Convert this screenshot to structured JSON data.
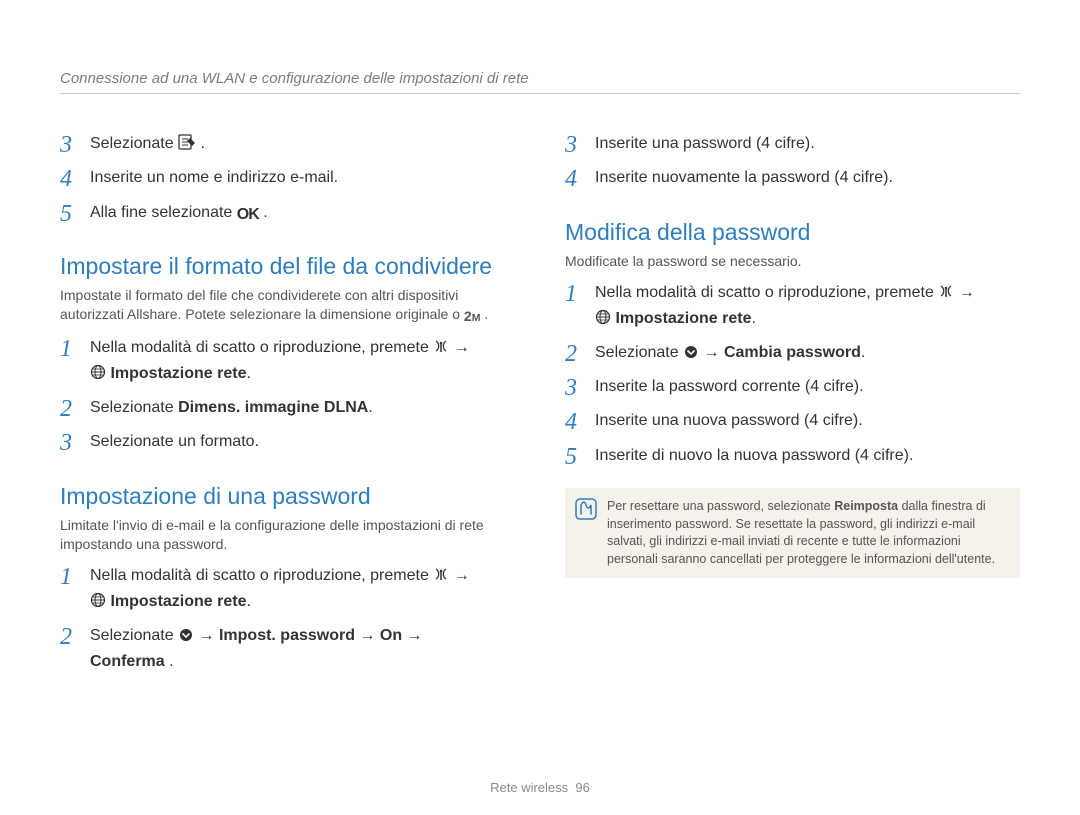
{
  "breadcrumb": "Connessione ad una WLAN e configurazione delle impostazioni di rete",
  "left": {
    "top_steps": [
      {
        "n": "3",
        "pre": "Selezionate ",
        "icon": "note-edit",
        "post": "."
      },
      {
        "n": "4",
        "pre": "Inserite un nome e indirizzo e-mail."
      },
      {
        "n": "5",
        "pre": "Alla fine selezionate ",
        "icon": "ok-text",
        "post": "."
      }
    ],
    "sec1_title": "Impostare il formato del file da condividere",
    "sec1_desc_a": "Impostate il formato del file che condividerete con altri dispositivi autorizzati Allshare. Potete selezionare la dimensione originale o ",
    "sec1_desc_icon": "2m",
    "sec1_desc_b": ".",
    "sec1_steps": [
      {
        "n": "1",
        "pre": "Nella modalità di scatto o riproduzione, premete ",
        "icon": "antenna",
        "post": " → ",
        "icon2": "globe",
        "bold": "Impostazione rete",
        "tail": "."
      },
      {
        "n": "2",
        "pre": "Selezionate ",
        "bold": "Dimens. immagine DLNA",
        "tail": "."
      },
      {
        "n": "3",
        "pre": "Selezionate un formato."
      }
    ],
    "sec2_title": "Impostazione di una password",
    "sec2_desc": "Limitate l'invio di e-mail e la configurazione delle impostazioni di rete impostando una password.",
    "sec2_steps": [
      {
        "n": "1",
        "pre": "Nella modalità di scatto o riproduzione, premete ",
        "icon": "antenna",
        "post": " → ",
        "icon2": "globe",
        "bold": "Impostazione rete",
        "tail": "."
      },
      {
        "n": "2",
        "pre": "Selezionate ",
        "icon": "chevron-down",
        "post": " → ",
        "bold": "Impost. password",
        "tail": " → ",
        "bold2": "On",
        "tail2": " → ",
        "bold3": "Conferma",
        "tail3": " ."
      }
    ]
  },
  "right": {
    "top_steps": [
      {
        "n": "3",
        "pre": "Inserite una password (4 cifre)."
      },
      {
        "n": "4",
        "pre": "Inserite nuovamente la password (4 cifre)."
      }
    ],
    "sec1_title": "Modifica della password",
    "sec1_desc": "Modificate la password se necessario.",
    "sec1_steps": [
      {
        "n": "1",
        "pre": "Nella modalità di scatto o riproduzione, premete ",
        "icon": "antenna",
        "post": " → ",
        "icon2": "globe",
        "bold": "Impostazione rete",
        "tail": "."
      },
      {
        "n": "2",
        "pre": "Selezionate ",
        "icon": "chevron-down",
        "post": " → ",
        "bold": "Cambia password",
        "tail": "."
      },
      {
        "n": "3",
        "pre": "Inserite la password corrente (4 cifre)."
      },
      {
        "n": "4",
        "pre": "Inserite una nuova password (4 cifre)."
      },
      {
        "n": "5",
        "pre": "Inserite di nuovo la nuova password (4 cifre)."
      }
    ],
    "note_a": "Per resettare una password, selezionate ",
    "note_bold": "Reimposta",
    "note_b": " dalla finestra di inserimento password. Se resettate la password, gli indirizzi e-mail salvati, gli indirizzi e-mail inviati di recente e tutte le informazioni personali saranno cancellati per proteggere le informazioni dell'utente."
  },
  "footer_label": "Rete wireless",
  "footer_page": "96"
}
